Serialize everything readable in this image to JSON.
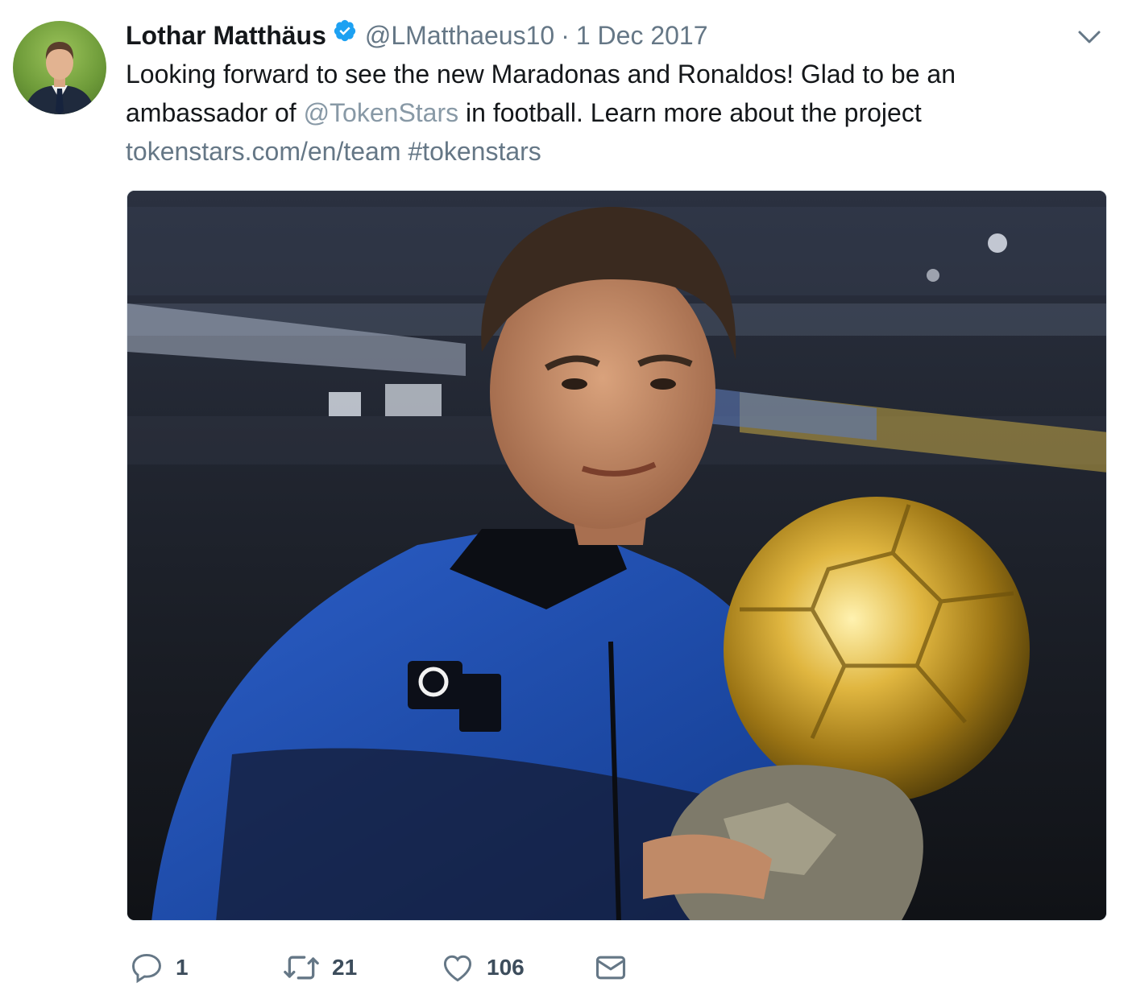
{
  "tweet": {
    "author_name": "Lothar Matthäus",
    "author_handle": "@LMatthaeus10",
    "separator": "·",
    "date": "1 Dec 2017",
    "text_line1": "Looking forward to see the new Maradonas and Ronaldos! Glad to be an",
    "text_line2_before": "ambassador of ",
    "mention": "@TokenStars",
    "text_line2_after": " in football. Learn more about the project",
    "link": "tokenstars.com/en/team",
    "hashtag": "#tokenstars"
  },
  "media": {
    "description_icon": "photo"
  },
  "actions": {
    "reply_count": "1",
    "retweet_count": "21",
    "like_count": "106"
  },
  "colors": {
    "verified": "#1da1f2",
    "muted_text": "#657786",
    "action_icon": "#657786"
  }
}
